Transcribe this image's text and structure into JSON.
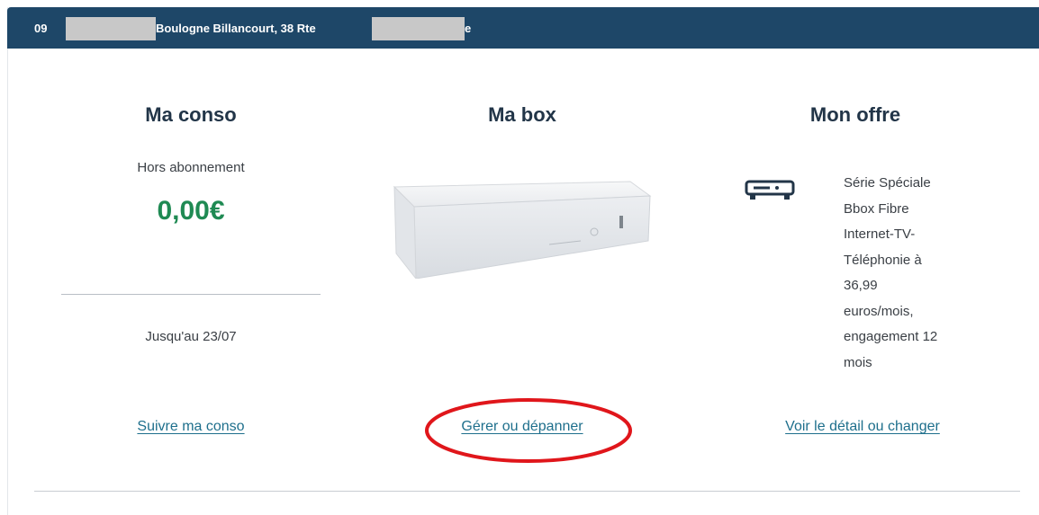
{
  "header": {
    "line_number": "09",
    "address": "Boulogne Billancourt, 38 Rte",
    "address_suffix": "e"
  },
  "conso": {
    "title": "Ma conso",
    "subtitle": "Hors abonnement",
    "amount": "0,00€",
    "until": "Jusqu'au 23/07",
    "link": "Suivre ma conso"
  },
  "box": {
    "title": "Ma box",
    "link": "Gérer ou dépanner"
  },
  "offre": {
    "title": "Mon offre",
    "icon": "bbox-device-icon",
    "description": "Série Spéciale\nBbox Fibre\nInternet-TV-\nTéléphonie à\n36,99\neuros/mois,\nengagement 12\nmois",
    "link": "Voir le détail ou changer"
  },
  "colors": {
    "header_bg": "#1e4768",
    "amount_green": "#1f8a53",
    "link_teal": "#1e6f8c",
    "title_navy": "#223548",
    "highlight_red": "#e0161b"
  }
}
